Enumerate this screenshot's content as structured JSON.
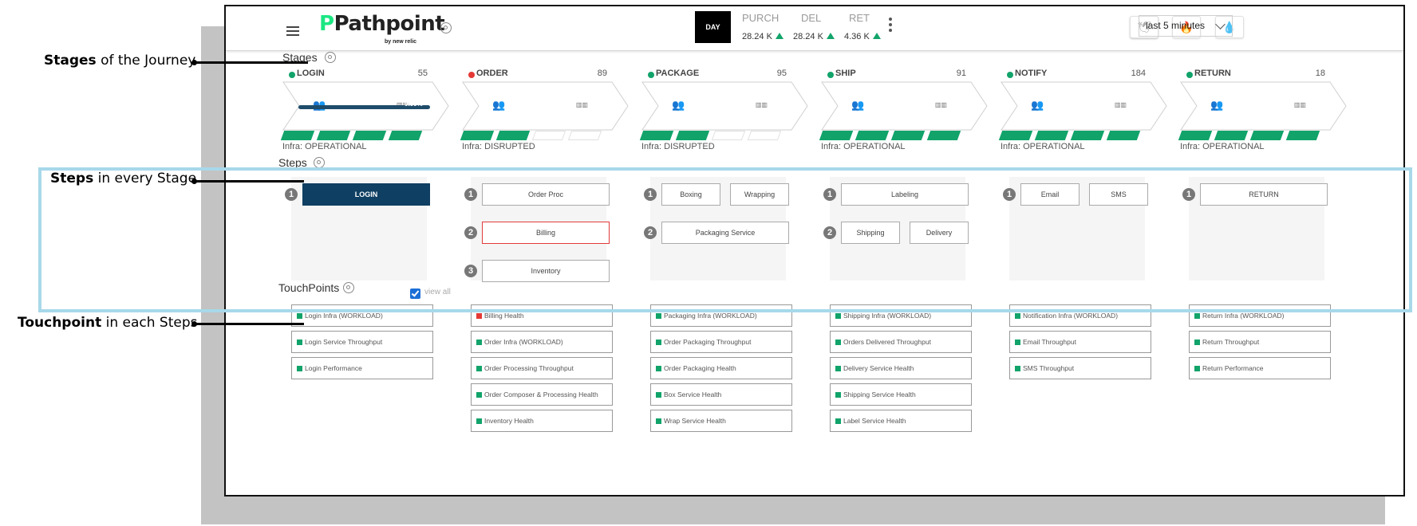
{
  "annotations": [
    {
      "bold": "Stages",
      "rest": " of the Journey"
    },
    {
      "bold": "Steps",
      "rest": " in every Stage"
    },
    {
      "bold": "Touchpoint",
      "rest": " in each Steps"
    }
  ],
  "header": {
    "logo_text": "Pathpoint",
    "logo_byline": "by new relic",
    "day_label": "DAY",
    "metrics": [
      {
        "label": "PURCH",
        "value": "28.24 K"
      },
      {
        "label": "DEL",
        "value": "28.24 K"
      },
      {
        "label": "RET",
        "value": "4.36 K"
      }
    ],
    "time_range": "last 5 minutes"
  },
  "sections": {
    "stages": "Stages",
    "steps": "Steps",
    "touchpoints": "TouchPoints",
    "view_all": "view all"
  },
  "colors": {
    "ok": "#11a36a",
    "error": "#e53935",
    "active": "#0f3f62"
  },
  "stages": [
    {
      "name": "LOGIN",
      "count": "55",
      "status": "ok",
      "infra": "Infra: OPERATIONAL",
      "infra_filled": 4,
      "progress": "9.09%"
    },
    {
      "name": "ORDER",
      "count": "89",
      "status": "error",
      "infra": "Infra: DISRUPTED",
      "infra_filled": 2
    },
    {
      "name": "PACKAGE",
      "count": "95",
      "status": "ok",
      "infra": "Infra: DISRUPTED",
      "infra_filled": 2
    },
    {
      "name": "SHIP",
      "count": "91",
      "status": "ok",
      "infra": "Infra: OPERATIONAL",
      "infra_filled": 4
    },
    {
      "name": "NOTIFY",
      "count": "184",
      "status": "ok",
      "infra": "Infra: OPERATIONAL",
      "infra_filled": 4
    },
    {
      "name": "RETURN",
      "count": "18",
      "status": "ok",
      "infra": "Infra: OPERATIONAL",
      "infra_filled": 4
    }
  ],
  "steps": [
    [
      {
        "num": "1",
        "items": [
          {
            "label": "LOGIN",
            "state": "active"
          }
        ]
      }
    ],
    [
      {
        "num": "1",
        "items": [
          {
            "label": "Order Proc"
          }
        ]
      },
      {
        "num": "2",
        "items": [
          {
            "label": "Billing",
            "state": "alert"
          }
        ]
      },
      {
        "num": "3",
        "items": [
          {
            "label": "Inventory"
          }
        ]
      }
    ],
    [
      {
        "num": "1",
        "items": [
          {
            "label": "Boxing"
          },
          {
            "label": "Wrapping"
          }
        ]
      },
      {
        "num": "2",
        "items": [
          {
            "label": "Packaging Service"
          }
        ]
      }
    ],
    [
      {
        "num": "1",
        "items": [
          {
            "label": "Labeling"
          }
        ]
      },
      {
        "num": "2",
        "items": [
          {
            "label": "Shipping"
          },
          {
            "label": "Delivery"
          }
        ]
      }
    ],
    [
      {
        "num": "1",
        "items": [
          {
            "label": "Email"
          },
          {
            "label": "SMS"
          }
        ]
      }
    ],
    [
      {
        "num": "1",
        "items": [
          {
            "label": "RETURN"
          }
        ]
      }
    ]
  ],
  "touchpoints": [
    [
      {
        "label": "Login Infra (WORKLOAD)",
        "status": "ok"
      },
      {
        "label": "Login Service Throughput",
        "status": "ok"
      },
      {
        "label": "Login Performance",
        "status": "ok"
      }
    ],
    [
      {
        "label": "Billing Health",
        "status": "error"
      },
      {
        "label": "Order Infra (WORKLOAD)",
        "status": "ok"
      },
      {
        "label": "Order Processing Throughput",
        "status": "ok"
      },
      {
        "label": "Order Composer & Processing Health",
        "status": "ok"
      },
      {
        "label": "Inventory Health",
        "status": "ok"
      }
    ],
    [
      {
        "label": "Packaging Infra (WORKLOAD)",
        "status": "ok"
      },
      {
        "label": "Order Packaging Throughput",
        "status": "ok"
      },
      {
        "label": "Order Packaging Health",
        "status": "ok"
      },
      {
        "label": "Box Service Health",
        "status": "ok"
      },
      {
        "label": "Wrap Service Health",
        "status": "ok"
      }
    ],
    [
      {
        "label": "Shipping Infra (WORKLOAD)",
        "status": "ok"
      },
      {
        "label": "Orders Delivered Throughput",
        "status": "ok"
      },
      {
        "label": "Delivery Service Health",
        "status": "ok"
      },
      {
        "label": "Shipping Service Health",
        "status": "ok"
      },
      {
        "label": "Label Service Health",
        "status": "ok"
      }
    ],
    [
      {
        "label": "Notification Infra (WORKLOAD)",
        "status": "ok"
      },
      {
        "label": "Email Throughput",
        "status": "ok"
      },
      {
        "label": "SMS Throughput",
        "status": "ok"
      }
    ],
    [
      {
        "label": "Return Infra (WORKLOAD)",
        "status": "ok"
      },
      {
        "label": "Return Throughput",
        "status": "ok"
      },
      {
        "label": "Return Performance",
        "status": "ok"
      }
    ]
  ]
}
